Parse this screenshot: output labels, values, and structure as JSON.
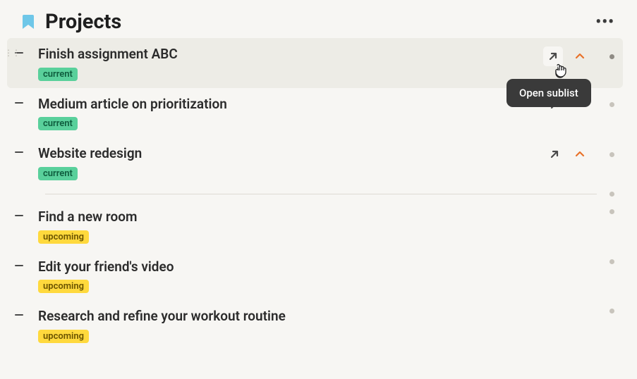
{
  "page": {
    "title": "Projects",
    "icon": "bookmark"
  },
  "tooltip_text": "Open sublist",
  "items": [
    {
      "title": "Finish assignment ABC",
      "tag": "current",
      "hovered": true,
      "show_arrow": true,
      "show_caret": true
    },
    {
      "title": "Medium article on prioritization",
      "tag": "current",
      "hovered": false,
      "show_arrow": true,
      "show_caret": true
    },
    {
      "title": "Website redesign",
      "tag": "current",
      "hovered": false,
      "show_arrow": true,
      "show_caret": true
    },
    {
      "divider": true
    },
    {
      "title": "Find a new room",
      "tag": "upcoming",
      "hovered": false,
      "show_arrow": false,
      "show_caret": false
    },
    {
      "title": "Edit your friend's video",
      "tag": "upcoming",
      "hovered": false,
      "show_arrow": false,
      "show_caret": false
    },
    {
      "title": "Research and refine your workout routine",
      "tag": "upcoming",
      "hovered": false,
      "show_arrow": false,
      "show_caret": false
    }
  ]
}
